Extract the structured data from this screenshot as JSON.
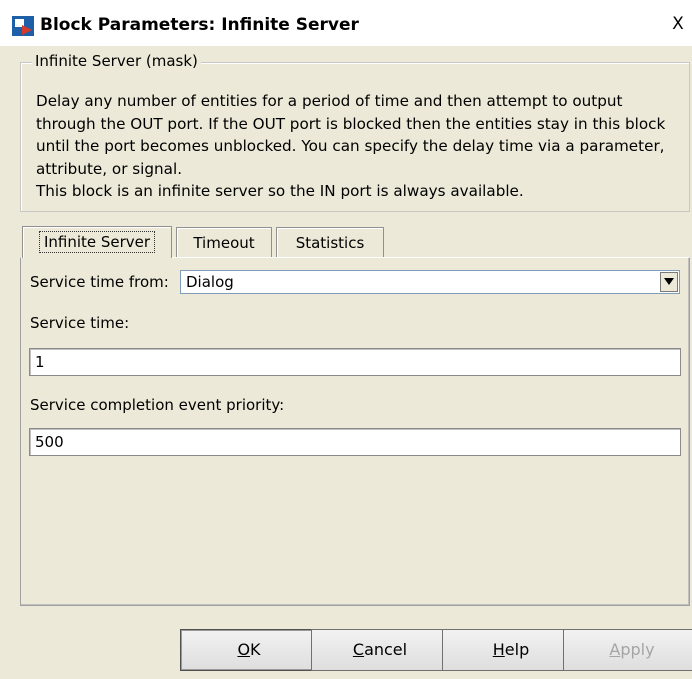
{
  "window": {
    "title": "Block Parameters: Infinite Server",
    "close_label": "X"
  },
  "mask": {
    "group_title": "Infinite Server (mask)",
    "description_lines": [
      "Delay any number of entities for a period of time and then attempt to output",
      "through the OUT port. If the OUT port is blocked then the entities stay in this block",
      "until the port becomes unblocked. You can specify the delay time via a parameter,",
      "attribute, or signal.",
      "This block is an infinite server so the IN port is always available."
    ]
  },
  "tabs": [
    {
      "label": "Infinite Server",
      "active": true
    },
    {
      "label": "Timeout",
      "active": false
    },
    {
      "label": "Statistics",
      "active": false
    }
  ],
  "params": {
    "service_time_from_label": "Service time from:",
    "service_time_from_value": "Dialog",
    "service_time_label": "Service time:",
    "service_time_value": "1",
    "priority_label": "Service completion event priority:",
    "priority_value": "500"
  },
  "buttons": {
    "ok": {
      "label": "OK",
      "mnemonic": "O",
      "rest": "K"
    },
    "cancel": {
      "label": "Cancel",
      "mnemonic": "C",
      "rest": "ancel"
    },
    "help": {
      "label": "Help",
      "mnemonic": "H",
      "rest": "elp"
    },
    "apply": {
      "label": "Apply",
      "mnemonic": "A",
      "rest": "pply",
      "disabled": true
    }
  },
  "icons": {
    "window": "simulink-block-icon",
    "dropdown": "chevron-down-icon"
  },
  "colors": {
    "background": "#ece9d8",
    "title_bg": "#ffffff"
  }
}
